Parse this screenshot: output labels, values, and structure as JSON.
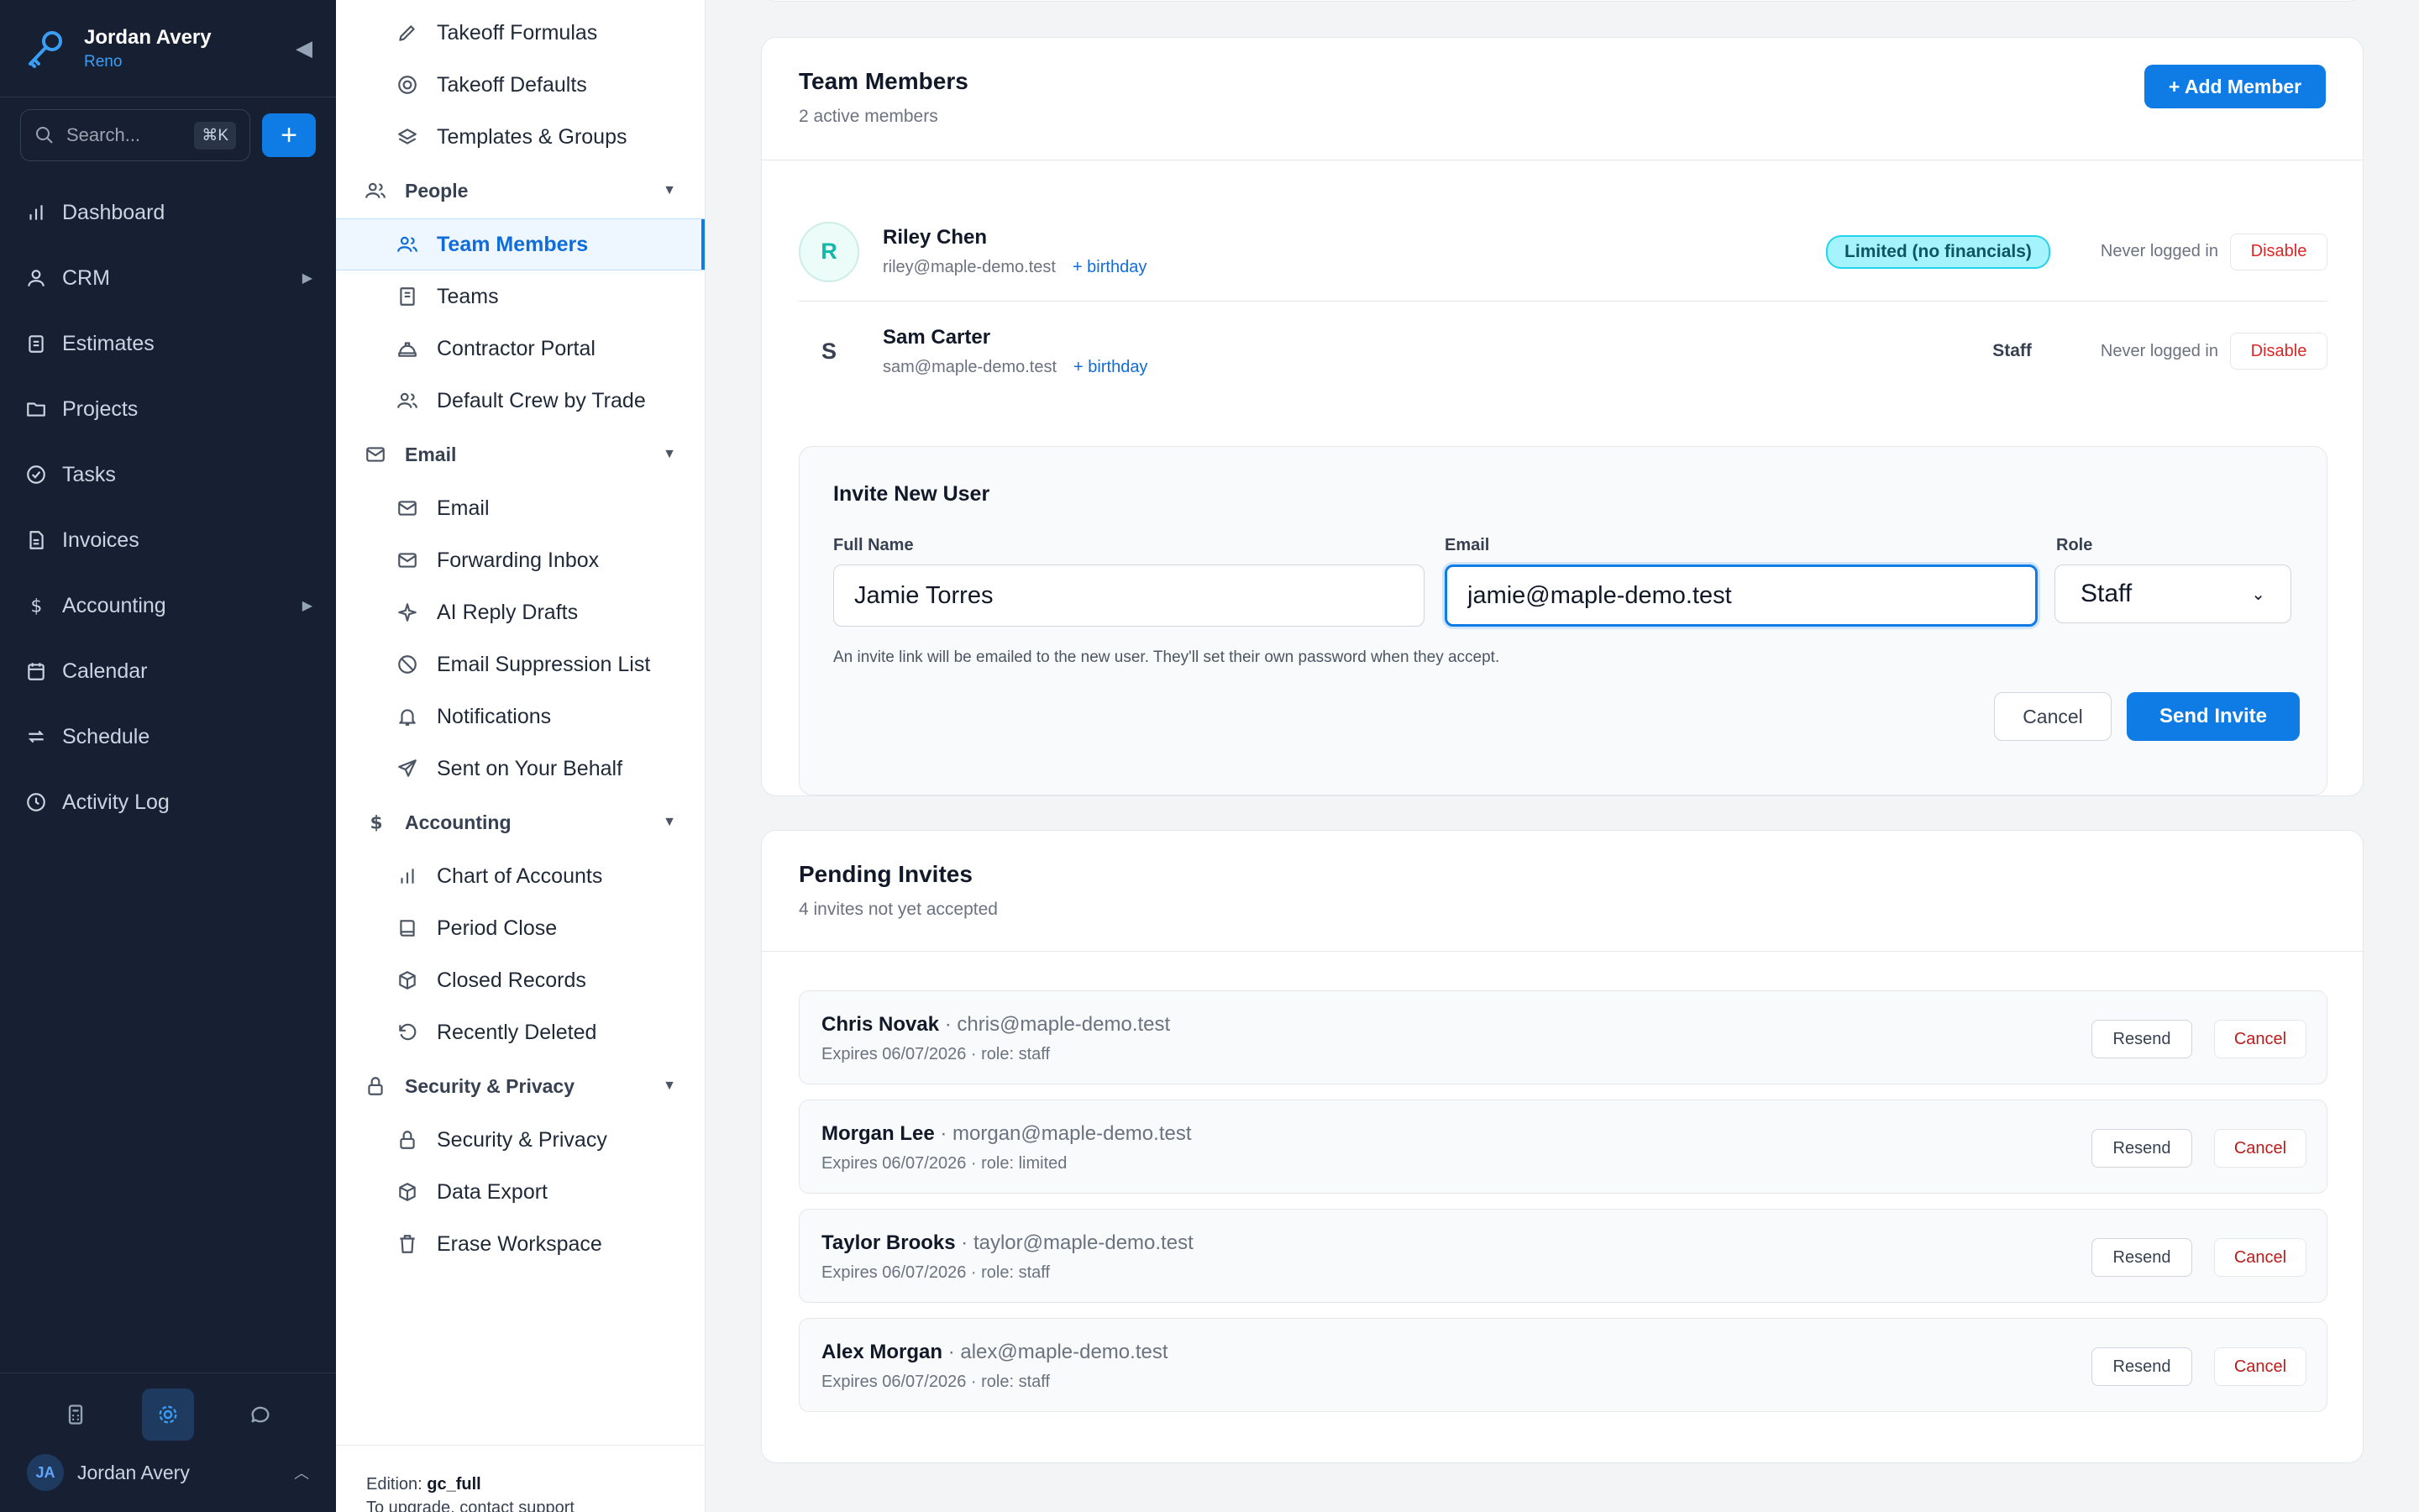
{
  "app": {
    "user_name": "Jordan Avery",
    "org_name": "Reno",
    "accent": "#0f7ce6",
    "sidebar_bg": "#172032"
  },
  "search": {
    "placeholder": "Search...",
    "shortcut": "⌘K"
  },
  "sidebar": {
    "items": [
      {
        "label": "Dashboard",
        "icon": "bar-chart-icon"
      },
      {
        "label": "CRM",
        "icon": "user-icon",
        "has_children": true
      },
      {
        "label": "Estimates",
        "icon": "clipboard-icon"
      },
      {
        "label": "Projects",
        "icon": "folder-icon"
      },
      {
        "label": "Tasks",
        "icon": "check-circle-icon"
      },
      {
        "label": "Invoices",
        "icon": "document-icon"
      },
      {
        "label": "Accounting",
        "icon": "dollar-icon",
        "has_children": true
      },
      {
        "label": "Calendar",
        "icon": "calendar-icon"
      },
      {
        "label": "Schedule",
        "icon": "repeat-icon"
      },
      {
        "label": "Activity Log",
        "icon": "clock-icon"
      }
    ],
    "footer": {
      "user_initials": "JA",
      "user_name": "Jordan Avery"
    }
  },
  "submenu": {
    "top_items": [
      {
        "label": "Takeoff Formulas",
        "icon": "pencil-icon"
      },
      {
        "label": "Takeoff Defaults",
        "icon": "target-icon"
      },
      {
        "label": "Templates & Groups",
        "icon": "layers-icon"
      }
    ],
    "groups": {
      "people": {
        "label": "People",
        "items": [
          "Team Members",
          "Teams",
          "Contractor Portal",
          "Default Crew by Trade"
        ]
      },
      "email": {
        "label": "Email",
        "items": [
          "Email",
          "Forwarding Inbox",
          "AI Reply Drafts",
          "Email Suppression List",
          "Notifications",
          "Sent on Your Behalf"
        ]
      },
      "accounting": {
        "label": "Accounting",
        "items": [
          "Chart of Accounts",
          "Period Close",
          "Closed Records",
          "Recently Deleted"
        ]
      },
      "security": {
        "label": "Security & Privacy",
        "items": [
          "Security & Privacy",
          "Data Export",
          "Erase Workspace"
        ]
      }
    },
    "active": "Team Members",
    "footer": {
      "edition_label": "Edition:",
      "edition_value": "gc_full",
      "upgrade_text": "To upgrade, contact support"
    }
  },
  "team": {
    "title": "Team Members",
    "subtitle": "2 active members",
    "add_button": "+ Add Member",
    "members": [
      {
        "initial": "R",
        "name": "Riley Chen",
        "email": "riley@maple-demo.test",
        "birthday_link": "+ birthday",
        "role": "Limited (no financials)",
        "last_login": "Never logged in",
        "action": "Disable"
      },
      {
        "initial": "S",
        "name": "Sam Carter",
        "email": "sam@maple-demo.test",
        "birthday_link": "+ birthday",
        "role": "Staff",
        "last_login": "Never logged in",
        "action": "Disable"
      }
    ]
  },
  "invite_form": {
    "title": "Invite New User",
    "full_name_label": "Full Name",
    "full_name_value": "Jamie Torres",
    "email_label": "Email",
    "email_value": "jamie@maple-demo.test",
    "role_label": "Role",
    "role_value": "Staff",
    "help_text": "An invite link will be emailed to the new user. They'll set their own password when they accept.",
    "cancel_label": "Cancel",
    "send_label": "Send Invite"
  },
  "pending": {
    "title": "Pending Invites",
    "subtitle": "4 invites not yet accepted",
    "resend_label": "Resend",
    "cancel_label": "Cancel",
    "invites": [
      {
        "name": "Chris Novak",
        "email": " · chris@maple-demo.test",
        "meta": "Expires 06/07/2026 · role: staff"
      },
      {
        "name": "Morgan Lee",
        "email": " · morgan@maple-demo.test",
        "meta": "Expires 06/07/2026 · role: limited"
      },
      {
        "name": "Taylor Brooks",
        "email": " · taylor@maple-demo.test",
        "meta": "Expires 06/07/2026 · role: staff"
      },
      {
        "name": "Alex Morgan",
        "email": " · alex@maple-demo.test",
        "meta": "Expires 06/07/2026 · role: staff"
      }
    ]
  }
}
